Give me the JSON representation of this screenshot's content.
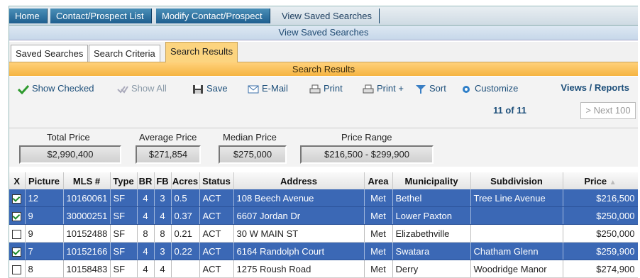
{
  "breadcrumbs": [
    "Home",
    "Contact/Prospect List",
    "Modify Contact/Prospect",
    "View Saved Searches"
  ],
  "page_subtitle": "View Saved Searches",
  "tabs": [
    {
      "label": "Saved Searches",
      "active": false
    },
    {
      "label": "Search Criteria",
      "active": false
    },
    {
      "label": "Search Results",
      "active": true
    }
  ],
  "section_title": "Search Results",
  "toolbar": {
    "show_checked": "Show Checked",
    "show_all": "Show All",
    "save": "Save",
    "email": "E-Mail",
    "print": "Print",
    "print_plus": "Print +",
    "sort": "Sort",
    "customize": "Customize",
    "views_reports": "Views / Reports",
    "pager": "11 of 11",
    "next": "> Next 100"
  },
  "stats": {
    "total_price_label": "Total Price",
    "total_price": "$2,990,400",
    "average_price_label": "Average Price",
    "average_price": "$271,854",
    "median_price_label": "Median Price",
    "median_price": "$275,000",
    "price_range_label": "Price Range",
    "price_range": "$216,500 - $299,900"
  },
  "columns": [
    "X",
    "Picture",
    "MLS #",
    "Type",
    "BR",
    "FB",
    "Acres",
    "Status",
    "Address",
    "Area",
    "Municipality",
    "Subdivision",
    "Price"
  ],
  "rows": [
    {
      "checked": true,
      "selected": true,
      "picture": "12",
      "mls": "10160061",
      "type": "SF",
      "br": "4",
      "fb": "3",
      "acres": "0.5",
      "status": "ACT",
      "address": "108 Beech Avenue",
      "area": "Met",
      "municipality": "Bethel",
      "subdivision": "Tree Line Avenue",
      "price": "$216,500"
    },
    {
      "checked": true,
      "selected": true,
      "picture": "9",
      "mls": "30000251",
      "type": "SF",
      "br": "4",
      "fb": "4",
      "acres": "0.37",
      "status": "ACT",
      "address": "6607 Jordan Dr",
      "area": "Met",
      "municipality": "Lower Paxton",
      "subdivision": "",
      "price": "$250,000"
    },
    {
      "checked": false,
      "selected": false,
      "picture": "9",
      "mls": "10152488",
      "type": "SF",
      "br": "8",
      "fb": "8",
      "acres": "0.21",
      "status": "ACT",
      "address": "30 W MAIN ST",
      "area": "Met",
      "municipality": "Elizabethville",
      "subdivision": "",
      "price": "$250,000"
    },
    {
      "checked": true,
      "selected": true,
      "picture": "7",
      "mls": "10152166",
      "type": "SF",
      "br": "4",
      "fb": "3",
      "acres": "0.22",
      "status": "ACT",
      "address": "6164 Randolph Court",
      "area": "Met",
      "municipality": "Swatara",
      "subdivision": "Chatham Glenn",
      "price": "$259,900"
    },
    {
      "checked": false,
      "selected": false,
      "picture": "8",
      "mls": "10158483",
      "type": "SF",
      "br": "4",
      "fb": "4",
      "acres": "",
      "status": "ACT",
      "address": "1275 Roush Road",
      "area": "Met",
      "municipality": "Derry",
      "subdivision": "Woodridge Manor",
      "price": "$274,900"
    }
  ]
}
